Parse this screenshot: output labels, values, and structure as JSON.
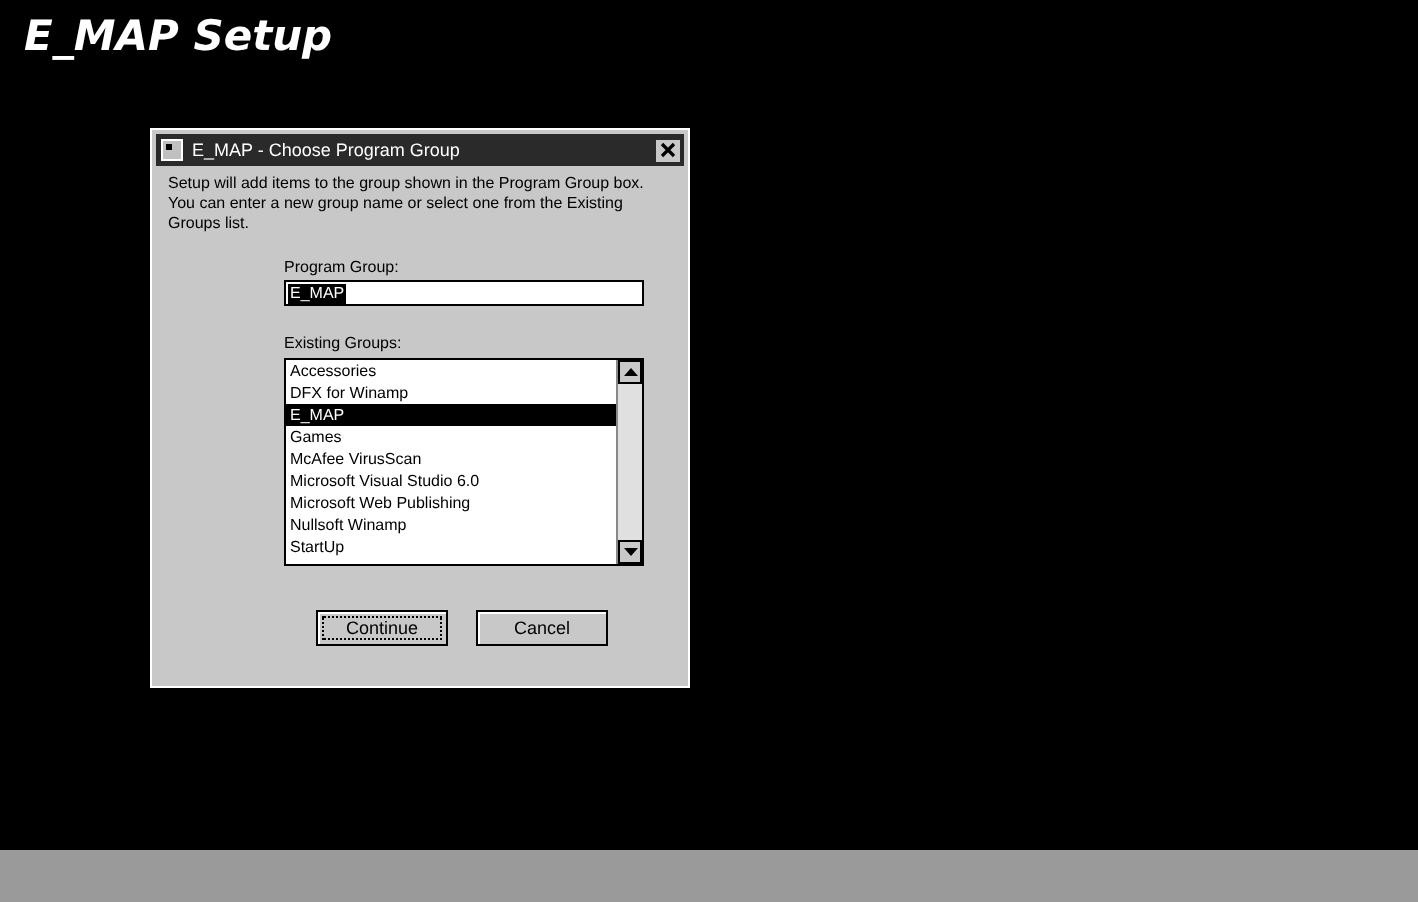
{
  "window": {
    "title": "E_MAP Setup"
  },
  "dialog": {
    "title": "E_MAP - Choose Program Group",
    "message": "Setup will add items to the group shown in the Program Group box. You can enter a new group name or select one from the Existing Groups list.",
    "program_group": {
      "label": "Program Group:",
      "value": "E_MAP"
    },
    "existing_groups": {
      "label": "Existing Groups:",
      "items": [
        {
          "label": "Accessories",
          "selected": false
        },
        {
          "label": "DFX for Winamp",
          "selected": false
        },
        {
          "label": "E_MAP",
          "selected": true
        },
        {
          "label": "Games",
          "selected": false
        },
        {
          "label": "McAfee VirusScan",
          "selected": false
        },
        {
          "label": "Microsoft Visual Studio 6.0",
          "selected": false
        },
        {
          "label": "Microsoft Web Publishing",
          "selected": false
        },
        {
          "label": "Nullsoft Winamp",
          "selected": false
        },
        {
          "label": "StartUp",
          "selected": false
        }
      ]
    },
    "buttons": [
      "Continue",
      "Cancel"
    ]
  }
}
